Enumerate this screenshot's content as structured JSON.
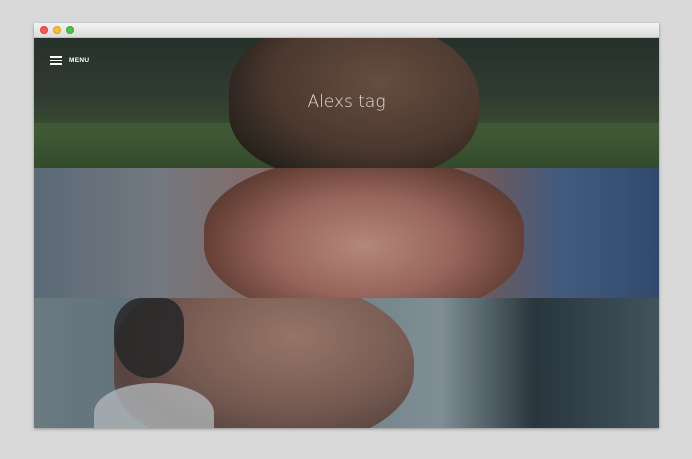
{
  "window": {
    "controls": [
      "close",
      "minimize",
      "zoom"
    ]
  },
  "header": {
    "menu_icon": "hamburger-icon",
    "menu_label": "MENU"
  },
  "hero": {
    "title": "Alexs tag"
  },
  "panels": [
    {
      "content": "man-profile-park"
    },
    {
      "content": "woman-eyes-closed"
    },
    {
      "content": "man-smiling-profile"
    }
  ]
}
